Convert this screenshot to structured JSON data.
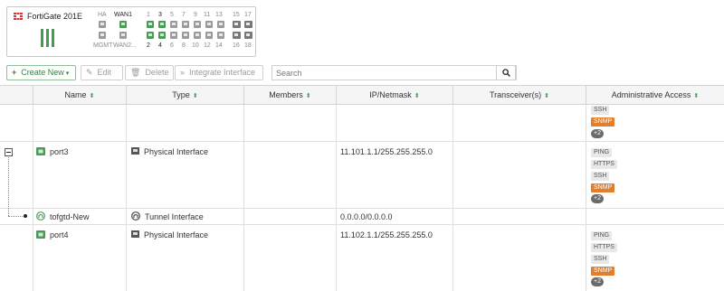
{
  "device": {
    "name": "FortiGate 201E",
    "top_labels": [
      "HA",
      "WAN1",
      "1",
      "3",
      "5",
      "7",
      "9",
      "11",
      "13",
      "15",
      "17"
    ],
    "bottom_labels": [
      "MGMT",
      "WAN2...",
      "2",
      "4",
      "6",
      "8",
      "10",
      "12",
      "14",
      "16",
      "18"
    ]
  },
  "toolbar": {
    "create_new": "Create New",
    "edit": "Edit",
    "delete": "Delete",
    "integrate": "Integrate Interface",
    "search_placeholder": "Search"
  },
  "table": {
    "headers": [
      "Name",
      "Type",
      "Members",
      "IP/Netmask",
      "Transceiver(s)",
      "Administrative Access"
    ],
    "rows": [
      {
        "name": "",
        "type": "",
        "ip": "",
        "access": [
          "SSH",
          "SNMP",
          "+2"
        ]
      },
      {
        "name": "port3",
        "type": "Physical Interface",
        "ip": "11.101.1.1/255.255.255.0",
        "access": [
          "PING",
          "HTTPS",
          "SSH",
          "SNMP",
          "+2"
        ]
      },
      {
        "name": "tofgtd-New",
        "type": "Tunnel Interface",
        "ip": "0.0.0.0/0.0.0.0",
        "access": []
      },
      {
        "name": "port4",
        "type": "Physical Interface",
        "ip": "11.102.1.1/255.255.255.0",
        "access": [
          "PING",
          "HTTPS",
          "SSH",
          "SNMP",
          "+2"
        ]
      }
    ]
  },
  "colors": {
    "accent": "#4c9a5a",
    "snmp_badge": "#e37f2b",
    "logo": "#d9302c"
  }
}
